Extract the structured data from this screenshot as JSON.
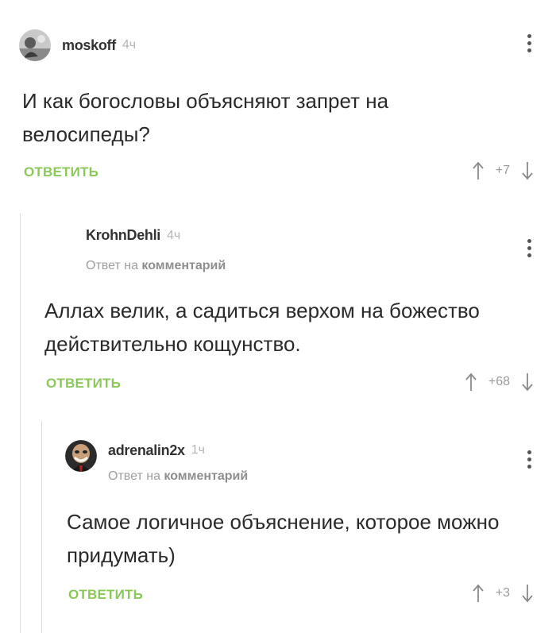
{
  "comments": [
    {
      "author": "moskoff",
      "time": "4ч",
      "body": "И как богословы объясняют запрет на велосипеды?",
      "reply_label": "ОТВЕТИТЬ",
      "score": "+7"
    },
    {
      "author": "KrohnDehli",
      "time": "4ч",
      "reply_to_prefix": "Ответ на",
      "reply_to_link": "комментарий",
      "body": "Аллах велик, а садиться верхом на божество действительно кощунство.",
      "reply_label": "ОТВЕТИТЬ",
      "score": "+68"
    },
    {
      "author": "adrenalin2x",
      "time": "1ч",
      "reply_to_prefix": "Ответ на",
      "reply_to_link": "комментарий",
      "body": "Самое логичное объяснение, которое можно придумать)",
      "reply_label": "ОТВЕТИТЬ",
      "score": "+3"
    }
  ],
  "colors": {
    "reply_button": "#8ac858",
    "thread_line": "#dcdcdc"
  },
  "icons": [
    "user-avatar",
    "more-vertical-icon",
    "arrow-up-icon",
    "arrow-down-icon"
  ]
}
